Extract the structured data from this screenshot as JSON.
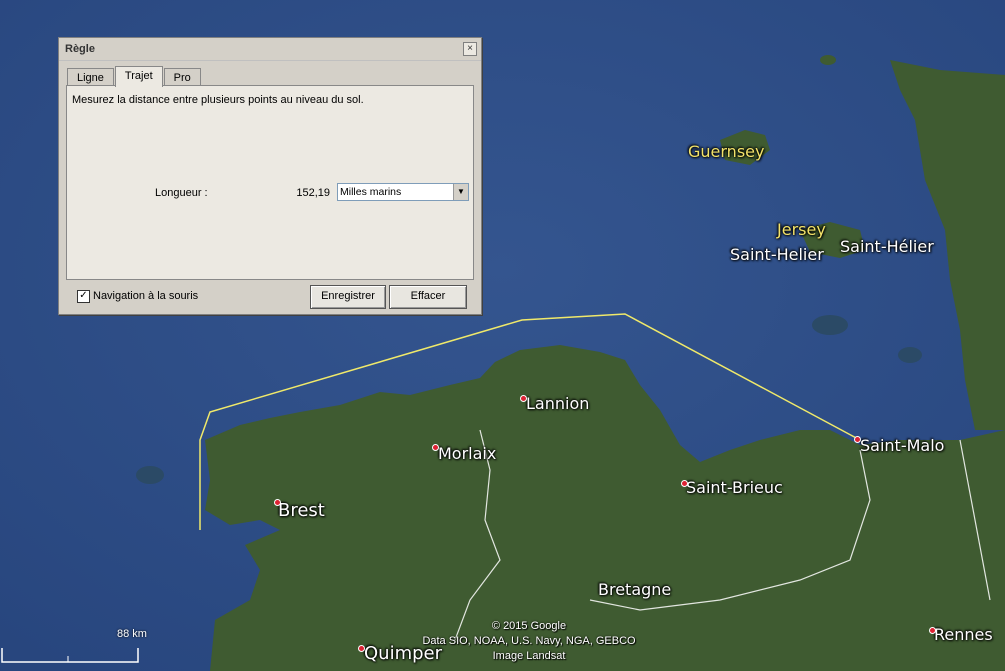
{
  "dialog": {
    "title": "Règle",
    "close_glyph": "×",
    "tabs": [
      "Ligne",
      "Trajet",
      "Pro"
    ],
    "active_tab": "Trajet",
    "description": "Mesurez la distance entre plusieurs points au niveau du sol.",
    "length_label": "Longueur :",
    "length_value": "152,19",
    "unit_selected": "Milles marins",
    "mouse_nav_label": "Navigation à la souris",
    "mouse_nav_checked": true,
    "save_label": "Enregistrer",
    "clear_label": "Effacer"
  },
  "map": {
    "places": {
      "guernsey": "Guernsey",
      "jersey": "Jersey",
      "saint_helier_1": "Saint-Helier",
      "saint_helier_2": "Saint-Hélier",
      "lannion": "Lannion",
      "morlaix": "Morlaix",
      "saint_brieuc": "Saint-Brieuc",
      "saint_malo": "Saint-Malo",
      "brest": "Brest",
      "bretagne": "Bretagne",
      "quimper": "Quimper",
      "rennes": "Rennes"
    },
    "attribution": [
      "© 2015 Google",
      "Data SIO, NOAA, U.S. Navy, NGA, GEBCO",
      "Image Landsat"
    ],
    "scale_label": "88 km",
    "colors": {
      "sea": "#2f4f8f",
      "land": "#3d5a2e",
      "path": "#f0e96a",
      "border": "#ffffff"
    }
  }
}
